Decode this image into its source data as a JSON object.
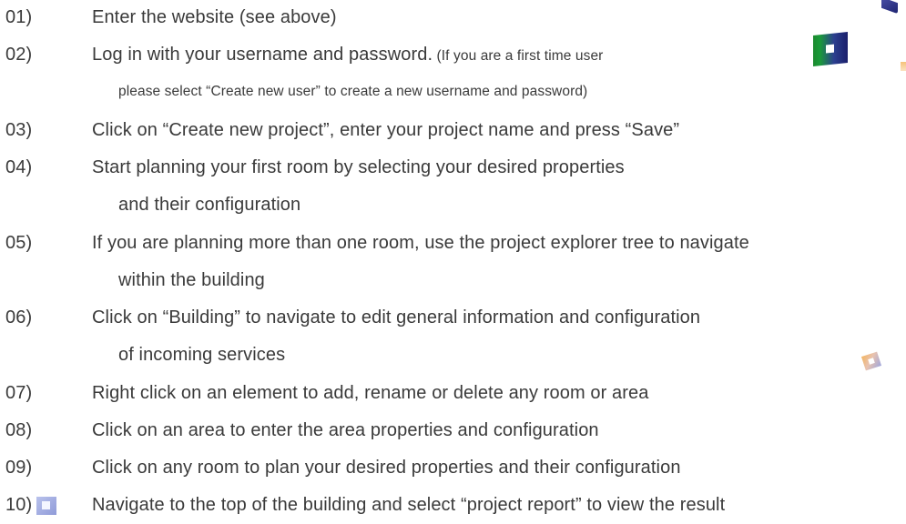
{
  "steps": [
    {
      "num": "01)",
      "lines": [
        {
          "parts": [
            "Enter the website (see above)"
          ]
        }
      ]
    },
    {
      "num": "02)",
      "lines": [
        {
          "parts": [
            "Log in with your username and password.",
            " (If you are a first time user"
          ]
        },
        {
          "parts": [
            "please select “Create new user” to  create a new username and password)"
          ]
        }
      ]
    },
    {
      "num": "03)",
      "lines": [
        {
          "parts": [
            "Click on “Create new project”,  enter your project name and press “Save”"
          ]
        }
      ]
    },
    {
      "num": "04)",
      "lines": [
        {
          "parts": [
            "Start planning your first room by selecting your desired properties"
          ]
        },
        {
          "parts": [
            "and their configuration"
          ]
        }
      ]
    },
    {
      "num": "05)",
      "lines": [
        {
          "parts": [
            "If you are planning more than one room, use the project explorer tree to navigate"
          ]
        },
        {
          "parts": [
            "within the building"
          ]
        }
      ]
    },
    {
      "num": "06)",
      "lines": [
        {
          "parts": [
            "Click on “Building” to navigate to edit general information and configuration"
          ]
        },
        {
          "parts": [
            "of incoming services"
          ]
        }
      ]
    },
    {
      "num": "07)",
      "lines": [
        {
          "parts": [
            "Right click on an element to add, rename or delete any room or area"
          ]
        }
      ]
    },
    {
      "num": "08)",
      "lines": [
        {
          "parts": [
            "Click on an area to enter the area properties and configuration"
          ]
        }
      ]
    },
    {
      "num": "09)",
      "lines": [
        {
          "parts": [
            "Click on any room to plan your desired properties and their configuration"
          ]
        }
      ]
    },
    {
      "num": "10)",
      "lines": [
        {
          "parts": [
            "Navigate to the top of the building and select “project report” to view the result"
          ]
        }
      ]
    }
  ],
  "decor": {
    "text_color": "#3a3a3a",
    "green_square_colors": [
      "#1b8a2e",
      "#1a1f6b"
    ],
    "pastel_square_colors": [
      "#f3b45f",
      "#9fa6dd"
    ],
    "blue_square_color": "#b9c2ec"
  }
}
